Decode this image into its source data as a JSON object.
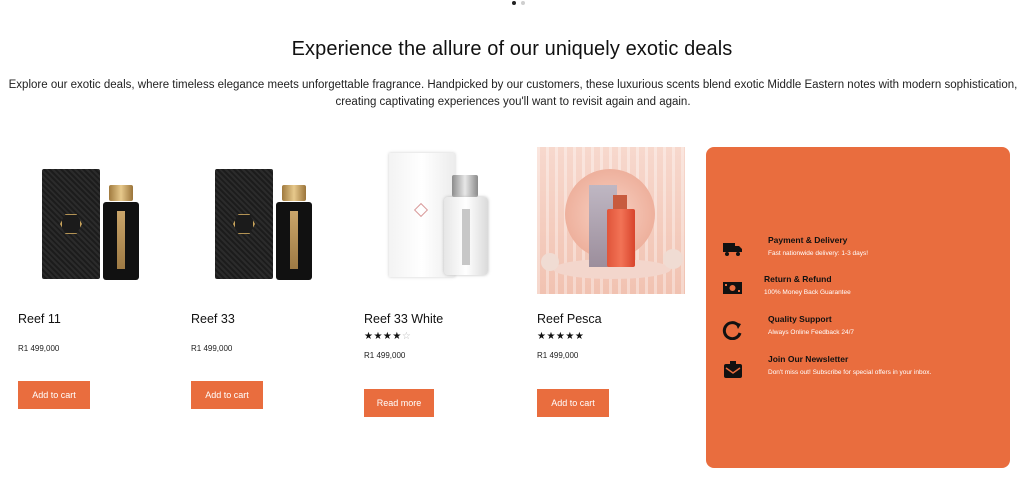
{
  "section": {
    "title": "Experience the allure of our uniquely exotic deals",
    "description": "Explore our exotic deals, where timeless elegance meets unforgettable fragrance. Handpicked by our customers, these luxurious scents blend exotic Middle Eastern notes with modern sophistication, creating captivating experiences you'll want to revisit again and again."
  },
  "products": [
    {
      "name": "Reef 11",
      "price": "R1 499,000",
      "button": "Add to cart",
      "rating": null
    },
    {
      "name": "Reef 33",
      "price": "R1 499,000",
      "button": "Add to cart",
      "rating": null
    },
    {
      "name": "Reef 33 White",
      "price": "R1 499,000",
      "button": "Read more",
      "rating": 4
    },
    {
      "name": "Reef Pesca",
      "price": "R1 499,000",
      "button": "Add to cart",
      "rating": 5
    }
  ],
  "features": [
    {
      "icon": "truck-icon",
      "title": "Payment & Delivery",
      "description": "Fast nationwide delivery: 1-3 days!"
    },
    {
      "icon": "money-icon",
      "title": "Return & Refund",
      "description": "100% Money Back Guarantee"
    },
    {
      "icon": "refresh-icon",
      "title": "Quality Support",
      "description": "Always Online Feedback 24/7"
    },
    {
      "icon": "mail-icon",
      "title": "Join Our Newsletter",
      "description": "Don't miss out! Subscribe for special offers in your inbox."
    }
  ],
  "colors": {
    "accent": "#e96d3e"
  }
}
